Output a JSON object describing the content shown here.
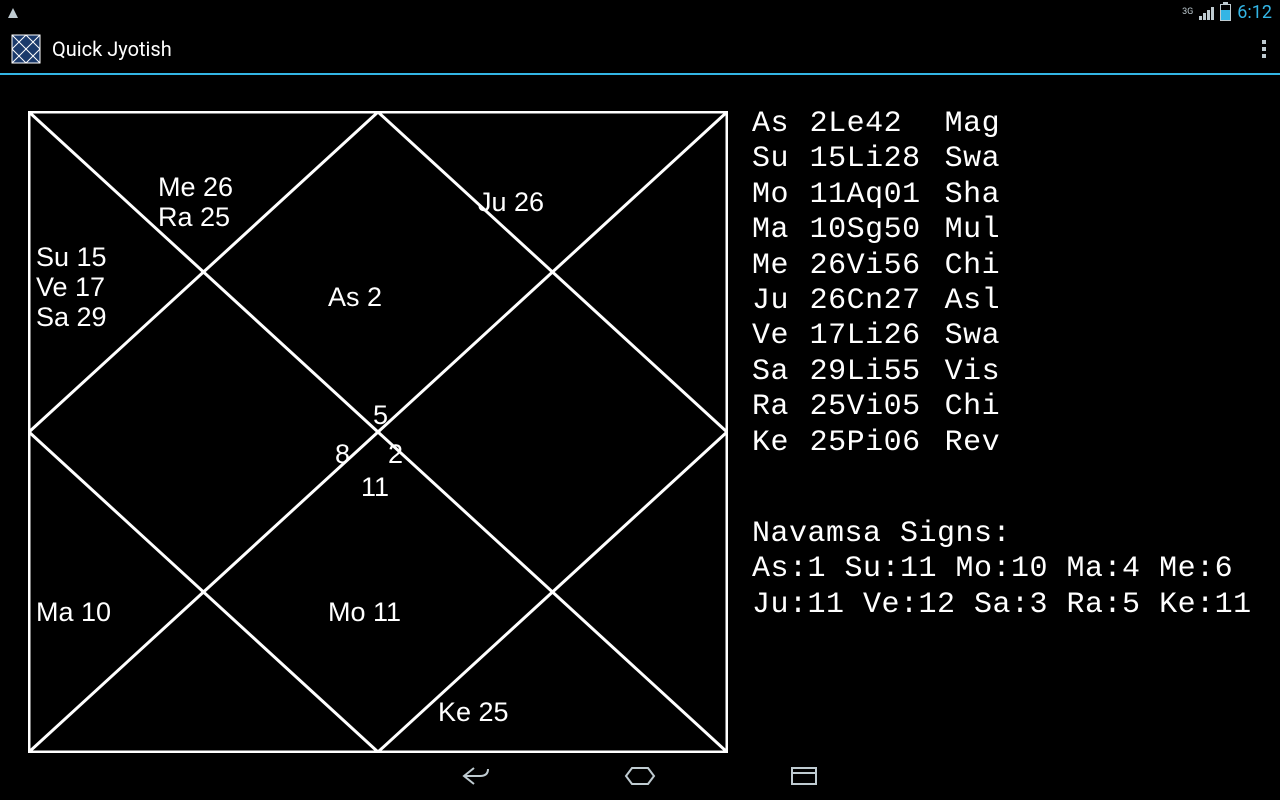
{
  "status": {
    "clock": "6:12",
    "net_label": "3G"
  },
  "action": {
    "title": "Quick Jyotish"
  },
  "chart": {
    "houses": {
      "h1": "As 2",
      "h2": [
        "Me 26",
        "Ra 25"
      ],
      "h3": [
        "Su 15",
        "Ve 17",
        "Sa 29"
      ],
      "h4": "",
      "h5": "Ma 10",
      "h6": "",
      "h7": "Mo 11",
      "h8": "Ke 25",
      "h9": "",
      "h10": "",
      "h11": "",
      "h12": "Ju 26"
    },
    "center": {
      "top": "5",
      "left": "8",
      "right": "2",
      "bottom": "11"
    }
  },
  "positions": [
    {
      "pl": "As",
      "pos": " 2Le42",
      "nak": "Mag"
    },
    {
      "pl": "Su",
      "pos": "15Li28",
      "nak": "Swa"
    },
    {
      "pl": "Mo",
      "pos": "11Aq01",
      "nak": "Sha"
    },
    {
      "pl": "Ma",
      "pos": "10Sg50",
      "nak": "Mul"
    },
    {
      "pl": "Me",
      "pos": "26Vi56",
      "nak": "Chi"
    },
    {
      "pl": "Ju",
      "pos": "26Cn27",
      "nak": "Asl"
    },
    {
      "pl": "Ve",
      "pos": "17Li26",
      "nak": "Swa"
    },
    {
      "pl": "Sa",
      "pos": "29Li55",
      "nak": "Vis"
    },
    {
      "pl": "Ra",
      "pos": "25Vi05",
      "nak": "Chi"
    },
    {
      "pl": "Ke",
      "pos": "25Pi06",
      "nak": "Rev"
    }
  ],
  "navamsa": {
    "title": "Navamsa Signs:",
    "line1": "As:1 Su:11 Mo:10 Ma:4 Me:6",
    "line2": "Ju:11 Ve:12 Sa:3 Ra:5 Ke:11"
  }
}
